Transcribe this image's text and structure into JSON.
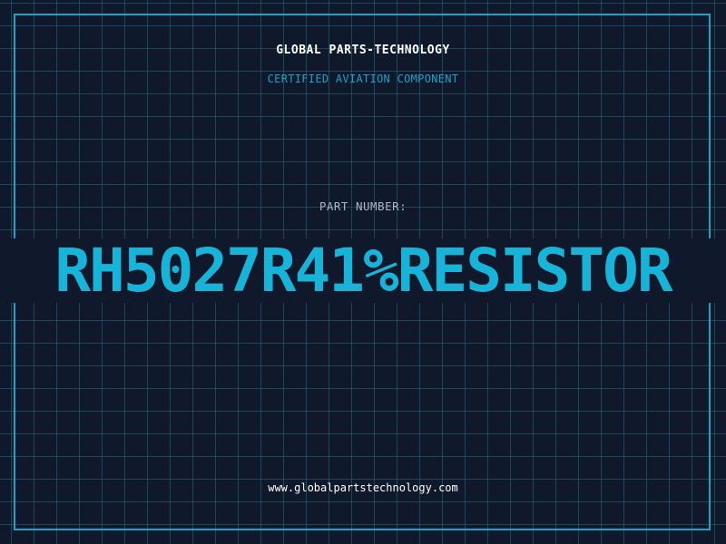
{
  "header": {
    "company": "GLOBAL PARTS-TECHNOLOGY",
    "tagline": "CERTIFIED AVIATION COMPONENT"
  },
  "part": {
    "label": "PART NUMBER:",
    "number": "RH5027R41%RESISTOR"
  },
  "footer": {
    "website": "www.globalpartstechnology.com"
  },
  "colors": {
    "background": "#10182b",
    "accent": "#16b4d8",
    "grid": "#266e82",
    "frame": "#1aa3c8"
  }
}
